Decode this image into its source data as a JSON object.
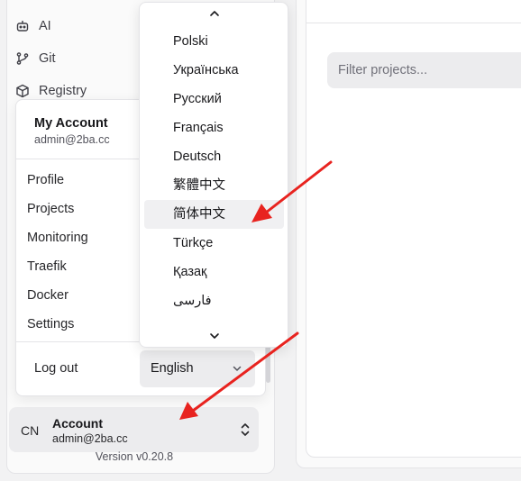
{
  "sidebar": {
    "nav_items": [
      {
        "label": "AI",
        "icon": "bot-icon"
      },
      {
        "label": "Git",
        "icon": "git-branch-icon"
      },
      {
        "label": "Registry",
        "icon": "package-icon"
      }
    ],
    "footer": {
      "badge": "CN",
      "name": "Account",
      "email": "admin@2ba.cc"
    },
    "version": "Version v0.20.8"
  },
  "main": {
    "filter_placeholder": "Filter projects..."
  },
  "account_menu": {
    "title": "My Account",
    "email": "admin@2ba.cc",
    "items": [
      "Profile",
      "Projects",
      "Monitoring",
      "Traefik",
      "Docker",
      "Settings"
    ],
    "logout": "Log out",
    "language_value": "English"
  },
  "language_list": {
    "options": [
      "Polski",
      "Українська",
      "Русский",
      "Français",
      "Deutsch",
      "繁體中文",
      "简体中文",
      "Türkçe",
      "Қазақ",
      "فارسی"
    ],
    "highlighted": "简体中文"
  },
  "colors": {
    "annotation_arrow": "#e8231f",
    "highlight_bg": "#f0f0f2"
  }
}
